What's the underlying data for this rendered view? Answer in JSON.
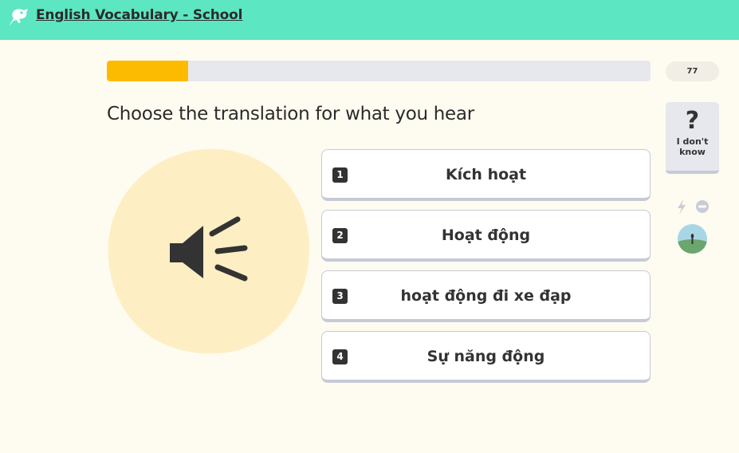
{
  "header": {
    "course_title": "English Vocabulary - School",
    "logo_icon": "memrise-logo-icon"
  },
  "progress": {
    "fraction": 0.15
  },
  "points": {
    "value": "77"
  },
  "question": {
    "prompt": "Choose the translation for what you hear",
    "audio_icon": "speaker-icon"
  },
  "answers": [
    {
      "number": "1",
      "text": "Kích hoạt"
    },
    {
      "number": "2",
      "text": "Hoạt động"
    },
    {
      "number": "3",
      "text": "hoạt động đi xe đạp"
    },
    {
      "number": "4",
      "text": "Sự năng động"
    }
  ],
  "sidebar": {
    "dont_know_icon": "question-mark-icon",
    "dont_know_label": "I don't know",
    "icons": [
      "lightning-icon",
      "block-icon",
      "avatar"
    ]
  },
  "colors": {
    "header_bg": "#5ce6c2",
    "page_bg": "#fefbf0",
    "progress_fill": "#fdbb00",
    "progress_track": "#e6e8ee",
    "audio_blob": "#fdefc3",
    "text": "#2b2b2b"
  }
}
